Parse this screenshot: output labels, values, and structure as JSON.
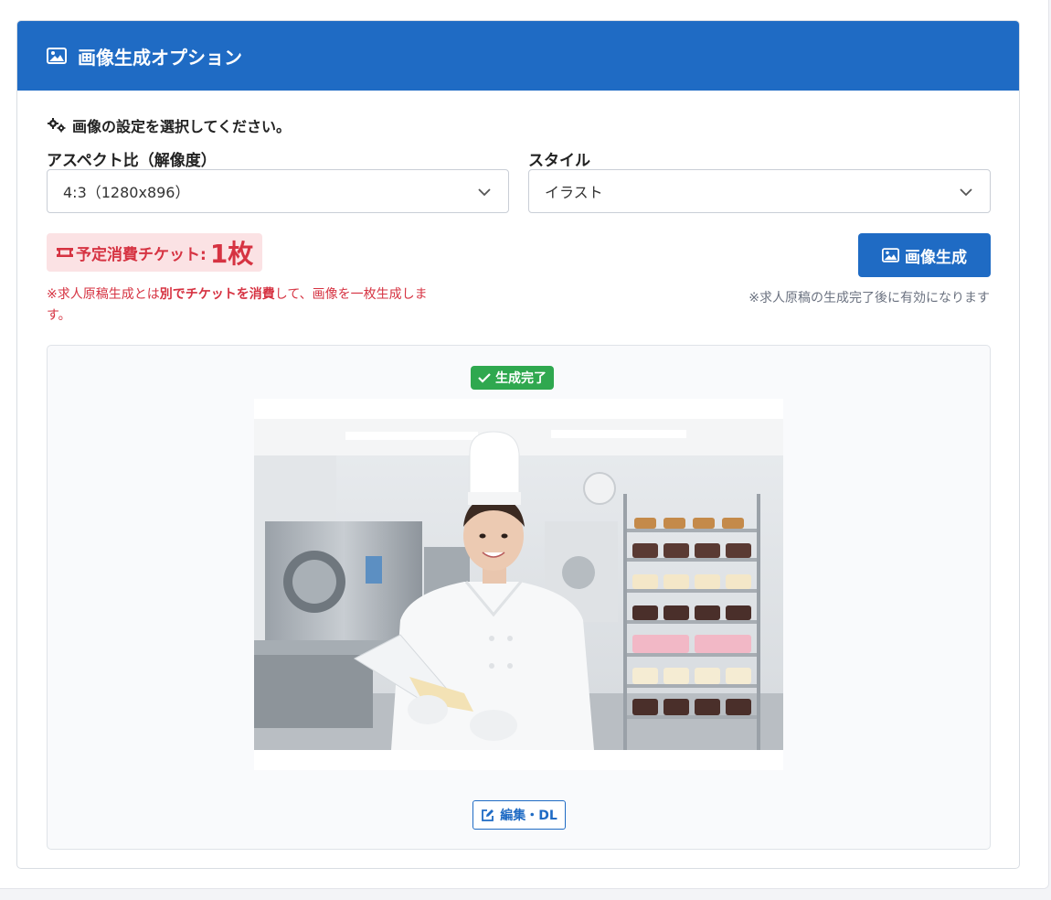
{
  "panel": {
    "title": "画像生成オプション",
    "title_icon": "image-icon"
  },
  "settings": {
    "instruction": "画像の設定を選択してください。",
    "instruction_icon": "gears-icon",
    "aspect": {
      "label": "アスペクト比（解像度）",
      "selected": "4:3（1280x896）"
    },
    "style": {
      "label": "スタイル",
      "selected": "イラスト"
    }
  },
  "ticket": {
    "icon": "ticket-icon",
    "label": "予定消費チケット:",
    "count": "1枚",
    "note_prefix": "※求人原稿生成とは",
    "note_bold": "別でチケットを消費",
    "note_suffix": "して、画像を一枚生成します。"
  },
  "generate": {
    "button_label": "画像生成",
    "button_icon": "image-icon",
    "note": "※求人原稿の生成完了後に有効になります"
  },
  "result": {
    "status": "生成完了",
    "status_icon": "check-icon",
    "edit_label": "編集・DL",
    "edit_icon": "edit-icon"
  },
  "colors": {
    "primary": "#1f6bc4",
    "danger": "#d63342",
    "success": "#2fa84f"
  }
}
